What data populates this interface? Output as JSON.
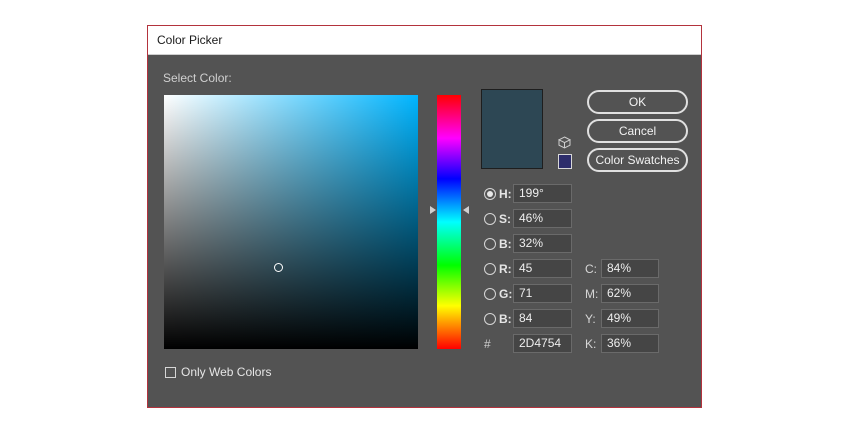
{
  "dialog": {
    "title": "Color Picker",
    "select_label": "Select Color:",
    "buttons": {
      "ok": "OK",
      "cancel": "Cancel",
      "swatches": "Color Swatches"
    },
    "current_color": "#2D4754",
    "hue_base_color": "#00b5ff",
    "accent_border": "#b3333d",
    "websafe_color": "#2d2d6b",
    "fields": {
      "h": {
        "label": "H:",
        "value": "199°"
      },
      "s": {
        "label": "S:",
        "value": "46%"
      },
      "b_hsb": {
        "label": "B:",
        "value": "32%"
      },
      "r": {
        "label": "R:",
        "value": "45"
      },
      "g": {
        "label": "G:",
        "value": "71"
      },
      "b_rgb": {
        "label": "B:",
        "value": "84"
      },
      "c": {
        "label": "C:",
        "value": "84%"
      },
      "m": {
        "label": "M:",
        "value": "62%"
      },
      "y": {
        "label": "Y:",
        "value": "49%"
      },
      "k": {
        "label": "K:",
        "value": "36%"
      },
      "hex": {
        "label": "#",
        "value": "2D4754"
      }
    },
    "only_web_colors_label": "Only Web Colors",
    "selected_mode": "H",
    "icons": [
      "cube-icon"
    ]
  }
}
